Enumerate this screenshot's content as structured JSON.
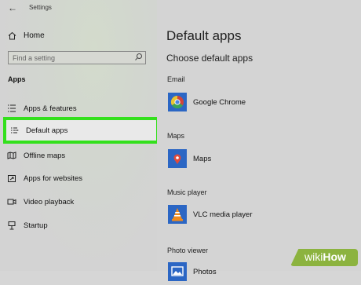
{
  "window": {
    "title": "Settings"
  },
  "sidebar": {
    "home_label": "Home",
    "search_placeholder": "Find a setting",
    "section_label": "Apps",
    "items": [
      {
        "label": "Apps & features",
        "icon": "list-icon"
      },
      {
        "label": "Default apps",
        "icon": "default-apps-icon",
        "selected": true
      },
      {
        "label": "Offline maps",
        "icon": "map-icon"
      },
      {
        "label": "Apps for websites",
        "icon": "external-link-icon"
      },
      {
        "label": "Video playback",
        "icon": "video-icon"
      },
      {
        "label": "Startup",
        "icon": "startup-icon"
      }
    ]
  },
  "main": {
    "title": "Default apps",
    "subtitle": "Choose default apps",
    "categories": [
      {
        "label": "Email",
        "app": "Google Chrome",
        "icon": "chrome-icon"
      },
      {
        "label": "Maps",
        "app": "Maps",
        "icon": "maps-icon"
      },
      {
        "label": "Music player",
        "app": "VLC media player",
        "icon": "vlc-icon"
      },
      {
        "label": "Photo viewer",
        "app": "Photos",
        "icon": "photos-icon"
      }
    ]
  },
  "watermark": {
    "wiki": "wiki",
    "how": "How"
  },
  "colors": {
    "highlight": "#33e01c",
    "tile": "#2b66c4",
    "watermark": "#8cb33f"
  }
}
